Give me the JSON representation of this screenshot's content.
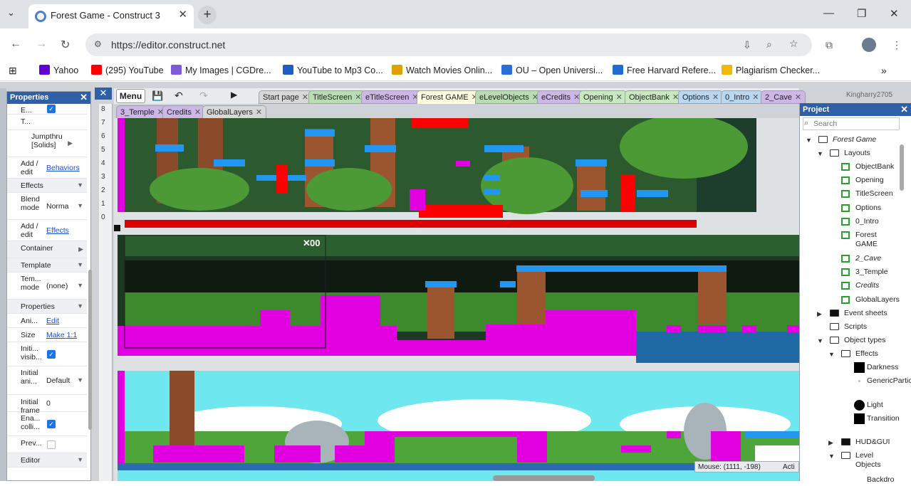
{
  "browser": {
    "tab_title": "Forest Game - Construct 3",
    "url": "https://editor.construct.net"
  },
  "bookmarks": [
    {
      "label": "Yahoo",
      "color": "#6001d2"
    },
    {
      "label": "(295) YouTube",
      "color": "#ff0000"
    },
    {
      "label": "My Images | CGDre...",
      "color": "#7d5bd6"
    },
    {
      "label": "YouTube to Mp3 Co...",
      "color": "#1f5cc4"
    },
    {
      "label": "Watch Movies Onlin...",
      "color": "#e0a100"
    },
    {
      "label": "OU – Open Universi...",
      "color": "#2a6fd6"
    },
    {
      "label": "Free Harvard Refere...",
      "color": "#1f6bd1"
    },
    {
      "label": "Plagiarism Checker...",
      "color": "#f2b705"
    }
  ],
  "properties": {
    "title": "Properties",
    "rows": [
      {
        "label": "E...",
        "type": "check",
        "checked": true
      },
      {
        "label": "T...",
        "value": ""
      },
      {
        "label": "Jumpthru [Solids]",
        "type": "sub"
      },
      {
        "label": "Add / edit",
        "link": "Behaviors"
      },
      {
        "label": "Effects",
        "type": "section"
      },
      {
        "label": "Blend mode",
        "select": "Norma"
      },
      {
        "label": "Add / edit",
        "link": "Effects"
      },
      {
        "label": "Container",
        "type": "section"
      },
      {
        "label": "Template",
        "type": "section"
      },
      {
        "label": "Tem... mode",
        "select": "(none)"
      },
      {
        "label": "Properties",
        "type": "section"
      },
      {
        "label": "Ani...",
        "link": "Edit"
      },
      {
        "label": "Size",
        "link": "Make 1:1"
      },
      {
        "label": "Initi... visib...",
        "type": "check",
        "checked": true
      },
      {
        "label": "Initial ani...",
        "select": "Default"
      },
      {
        "label": "Initial frame",
        "value": "0"
      },
      {
        "label": "Ena... colli...",
        "type": "check",
        "checked": true
      },
      {
        "label": "Prev...",
        "type": "check",
        "checked": false
      },
      {
        "label": "Editor",
        "type": "section"
      }
    ]
  },
  "editor": {
    "menu": "Menu",
    "tabs_row1": [
      "Start page",
      "TitleScreen",
      "eTitleScreen",
      "Forest GAME",
      "eLevelObjects",
      "eCredits",
      "Opening",
      "ObjectBank",
      "Options",
      "0_Intro",
      "2_Cave"
    ],
    "tabs_row2": [
      "3_Temple",
      "Credits",
      "GlobalLayers"
    ],
    "active_tab": "Forest GAME",
    "user": "Kingharry2705",
    "ruler": [
      "8",
      "7",
      "6",
      "5",
      "4",
      "3",
      "2",
      "1",
      "0"
    ],
    "hud_count": "00",
    "mouse": "Mouse: (1111, -198)",
    "acti": "Acti"
  },
  "project": {
    "title": "Project",
    "search_placeholder": "Search",
    "tree": [
      {
        "label": "Forest Game",
        "italic": true,
        "depth": 0,
        "icon": "folder",
        "open": true
      },
      {
        "label": "Layouts",
        "depth": 1,
        "icon": "folder",
        "open": true
      },
      {
        "label": "ObjectBank",
        "depth": 2,
        "icon": "layout"
      },
      {
        "label": "Opening",
        "depth": 2,
        "icon": "layout"
      },
      {
        "label": "TitleScreen",
        "depth": 2,
        "icon": "layout"
      },
      {
        "label": "Options",
        "depth": 2,
        "icon": "layout"
      },
      {
        "label": "0_Intro",
        "depth": 2,
        "icon": "layout"
      },
      {
        "label": "Forest GAME",
        "depth": 2,
        "icon": "layout",
        "two_line": true
      },
      {
        "label": "2_Cave",
        "italic": true,
        "depth": 2,
        "icon": "layout"
      },
      {
        "label": "3_Temple",
        "depth": 2,
        "icon": "layout"
      },
      {
        "label": "Credits",
        "italic": true,
        "depth": 2,
        "icon": "layout"
      },
      {
        "label": "GlobalLayers",
        "depth": 2,
        "icon": "layout"
      },
      {
        "label": "Event sheets",
        "depth": 1,
        "icon": "folder-dark",
        "open": false
      },
      {
        "label": "Scripts",
        "depth": 1,
        "icon": "folder"
      },
      {
        "label": "Object types",
        "depth": 1,
        "icon": "folder",
        "open": true
      },
      {
        "label": "Effects",
        "depth": 2,
        "icon": "folder",
        "open": true
      },
      {
        "label": "Darkness",
        "depth": 3,
        "icon": "black-square"
      },
      {
        "label": "GenericParticle",
        "depth": 3,
        "icon": "dot",
        "two_line": true
      },
      {
        "label": "Light",
        "depth": 3,
        "icon": "black-circle"
      },
      {
        "label": "Transition",
        "depth": 3,
        "icon": "black-square",
        "two_line": true
      },
      {
        "label": "HUD&GUI",
        "depth": 2,
        "icon": "folder-dark",
        "open": false
      },
      {
        "label": "Level Objects",
        "depth": 2,
        "icon": "folder",
        "open": true,
        "two_line": true
      },
      {
        "label": "Backdro",
        "depth": 3,
        "icon": "none"
      }
    ]
  }
}
